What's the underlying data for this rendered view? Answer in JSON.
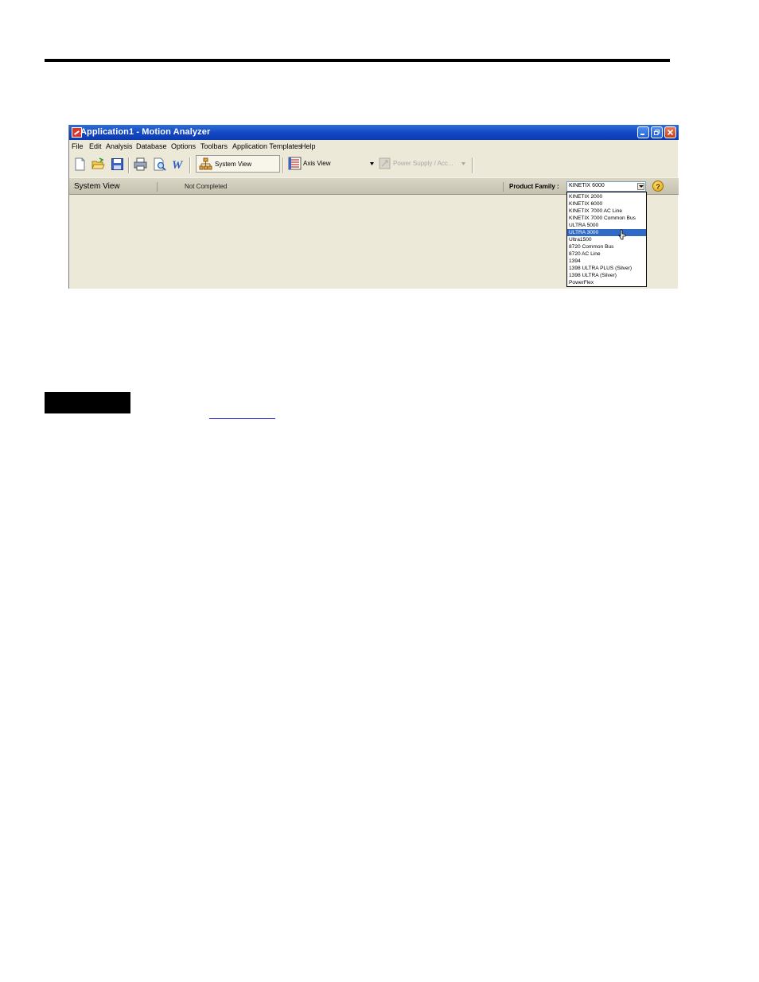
{
  "window": {
    "title": "Application1 - Motion Analyzer"
  },
  "menu": [
    "File",
    "Edit",
    "Analysis",
    "Database",
    "Options",
    "Toolbars",
    "Application Templates",
    "Help"
  ],
  "toolbar": {
    "system_view": "System View",
    "axis_view": "Axis View",
    "power_supply": "Power Supply / Acc..."
  },
  "status": {
    "view_title": "System View",
    "completion": "Not Completed",
    "product_family_label": "Product Family :",
    "product_family_value": "KINETIX 6000",
    "help": "?"
  },
  "dropdown": {
    "options": [
      "KINETIX 2000",
      "KINETIX 6000",
      "KINETIX 7000 AC Line",
      "KINETIX 7000 Common Bus",
      "ULTRA 5000",
      "ULTRA 3000",
      "Ultra1500",
      "8720 Common Bus",
      "8720 AC Line",
      "1394",
      "1398 ULTRA PLUS (Silver)",
      "1398 ULTRA (Silver)",
      "PowerFlex"
    ],
    "highlighted_index": 5
  },
  "colors": {
    "titlebar": "#1449c4",
    "window_bg": "#ece9d8",
    "selection": "#316ac5"
  }
}
